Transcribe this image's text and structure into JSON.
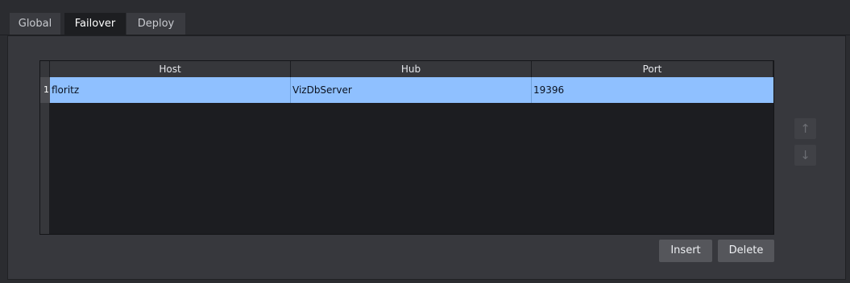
{
  "tabs": [
    {
      "label": "Global",
      "active": false
    },
    {
      "label": "Failover",
      "active": true
    },
    {
      "label": "Deploy",
      "active": false
    }
  ],
  "table": {
    "columns": [
      "Host",
      "Hub",
      "Port"
    ],
    "rows": [
      {
        "index": "1",
        "host": "floritz",
        "hub": "VizDbServer",
        "port": "19396",
        "selected": true
      }
    ]
  },
  "buttons": {
    "insert_label": "Insert",
    "delete_label": "Delete"
  },
  "side_controls": {
    "up_icon": "arrow-up-icon",
    "down_icon": "arrow-down-icon"
  },
  "colors": {
    "selection": "#8fc0ff",
    "background": "#2b2c30",
    "active_tab": "#1d1e21"
  }
}
